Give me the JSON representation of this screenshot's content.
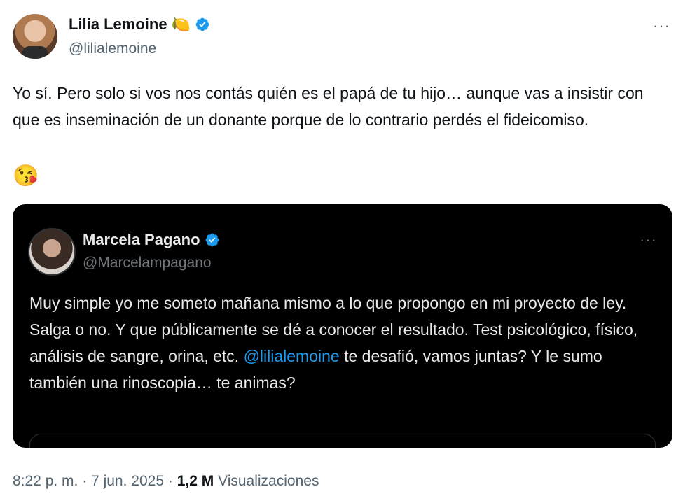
{
  "tweet": {
    "author_name": "Lilia Lemoine",
    "author_emoji": "🍋",
    "author_handle": "@lilialemoine",
    "text": "Yo sí. Pero solo si vos nos contás quién es el papá de tu hijo… aunque vas a insistir con que es inseminación de un donante porque de lo contrario perdés el fideicomiso.",
    "text_emoji": "😘",
    "more_label": "···"
  },
  "quoted": {
    "author_name": "Marcela Pagano",
    "author_handle": "@Marcelampagano",
    "more_label": "···",
    "text_part1": "Muy simple yo me someto mañana mismo a lo que propongo en mi proyecto de ley. Salga o no. Y que públicamente se dé a conocer el resultado. Test psicológico, físico, análisis de sangre, orina, etc. ",
    "mention": "@lilialemoine",
    "text_part2": " te desafió, vamos juntas? Y le sumo también una rinoscopia… te animas?"
  },
  "meta": {
    "time": "8:22 p. m.",
    "separator": "·",
    "date": "7 jun. 2025",
    "views_count": "1,2 M",
    "views_label": "Visualizaciones"
  },
  "colors": {
    "verified_blue": "#1d9bf0",
    "mention_blue": "#1d9bf0",
    "secondary_text": "#536471"
  }
}
